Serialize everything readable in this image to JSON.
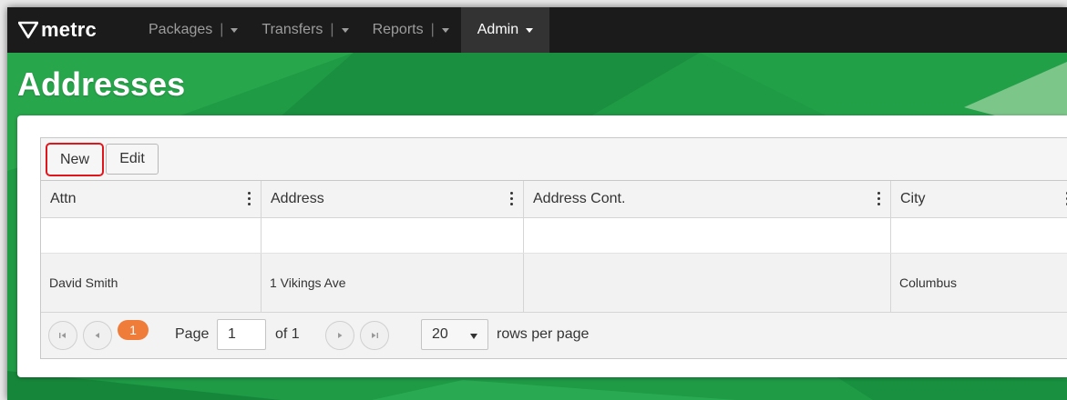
{
  "brand": {
    "name": "metrc",
    "icon": "metrc-logo-icon"
  },
  "navbar": {
    "items": [
      {
        "label": "Packages",
        "has_menu": true
      },
      {
        "label": "Transfers",
        "has_menu": true
      },
      {
        "label": "Reports",
        "has_menu": true
      },
      {
        "label": "Admin",
        "has_menu": true,
        "active": true
      }
    ]
  },
  "page": {
    "title": "Addresses"
  },
  "toolbar": {
    "new_label": "New",
    "edit_label": "Edit"
  },
  "grid": {
    "columns": [
      "Attn",
      "Address",
      "Address Cont.",
      "City"
    ],
    "rows": [
      {
        "attn": "David Smith",
        "address": "1 Vikings Ave",
        "address_cont": "",
        "city": "Columbus"
      }
    ]
  },
  "pager": {
    "current_page_badge": "1",
    "page_label": "Page",
    "page_value": "1",
    "of_label": "of 1",
    "rows_value": "20",
    "rows_label": "rows per page",
    "icons": [
      "first-page-icon",
      "prev-page-icon",
      "next-page-icon",
      "last-page-icon"
    ]
  },
  "colors": {
    "navbar": "#1b1b1b",
    "background_green": "#1f9a45",
    "highlight_red": "#e0161d",
    "page_badge": "#f07c3a"
  }
}
